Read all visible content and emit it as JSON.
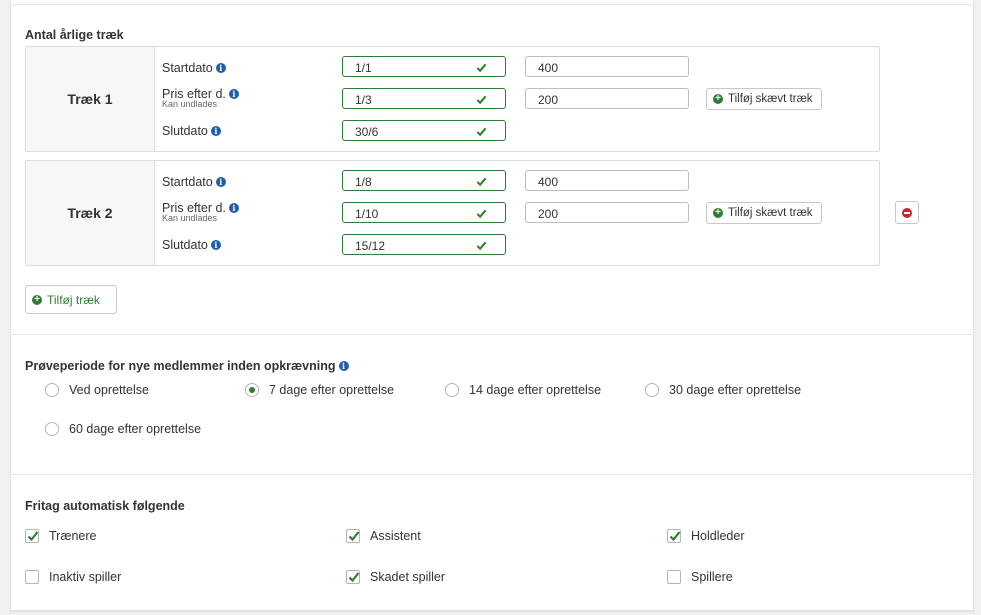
{
  "draws": {
    "title": "Antal årlige træk",
    "items": [
      {
        "name": "Træk 1",
        "start_label": "Startdato",
        "price_label": "Pris efter d.",
        "price_sub": "Kan undlades",
        "end_label": "Slutdato",
        "start_date": "1/1",
        "price_date": "1/3",
        "end_date": "30/6",
        "start_price": "400",
        "after_price": "200",
        "skew_label": "Tilføj skævt træk",
        "removable": false
      },
      {
        "name": "Træk 2",
        "start_label": "Startdato",
        "price_label": "Pris efter d.",
        "price_sub": "Kan undlades",
        "end_label": "Slutdato",
        "start_date": "1/8",
        "price_date": "1/10",
        "end_date": "15/12",
        "start_price": "400",
        "after_price": "200",
        "skew_label": "Tilføj skævt træk",
        "removable": true
      }
    ],
    "add_label": "Tilføj træk"
  },
  "trial": {
    "title": "Prøveperiode for nye medlemmer inden opkrævning",
    "options": [
      {
        "label": "Ved oprettelse",
        "selected": false
      },
      {
        "label": "7 dage efter oprettelse",
        "selected": true
      },
      {
        "label": "14 dage efter oprettelse",
        "selected": false
      },
      {
        "label": "30 dage efter oprettelse",
        "selected": false
      },
      {
        "label": "60 dage efter oprettelse",
        "selected": false
      }
    ]
  },
  "exempt": {
    "title": "Fritag automatisk følgende",
    "options": [
      {
        "label": "Trænere",
        "checked": true
      },
      {
        "label": "Assistent",
        "checked": true
      },
      {
        "label": "Holdleder",
        "checked": true
      },
      {
        "label": "Inaktiv spiller",
        "checked": false
      },
      {
        "label": "Skadet spiller",
        "checked": true
      },
      {
        "label": "Spillere",
        "checked": false
      }
    ]
  },
  "colors": {
    "accent": "#2e7d32",
    "info": "#1f5fa8",
    "danger": "#c62828"
  }
}
